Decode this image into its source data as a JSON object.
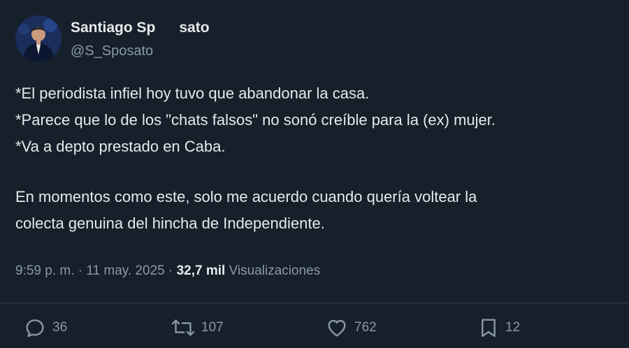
{
  "tweet": {
    "author_name_left": "Santiago Sp",
    "author_name_right": "sato",
    "handle": "@S_Sposato",
    "lines": [
      "*El periodista infiel hoy tuvo que abandonar la casa.",
      "*Parece que lo de los \"chats falsos\" no sonó creíble para la (ex) mujer.",
      "*Va a depto prestado en Caba."
    ],
    "lines2": [
      "En momentos como este, solo me acuerdo cuando quería voltear la",
      "colecta genuina del hincha de Independiente."
    ],
    "time": "9:59 p. m.",
    "sep": "·",
    "date": "11 may. 2025",
    "views_count": "32,7 mil",
    "views_label": "Visualizaciones"
  },
  "actions": {
    "replies": "36",
    "retweets": "107",
    "likes": "762",
    "bookmarks": "12"
  },
  "colors": {
    "background": "#15202b",
    "text": "#e7e9ea",
    "secondary": "#8b98a5",
    "divider": "#38444d"
  }
}
